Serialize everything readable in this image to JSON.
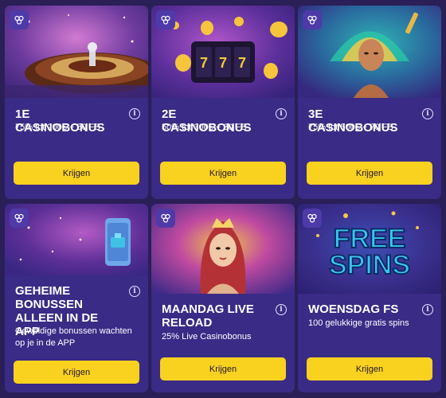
{
  "colors": {
    "page_bg": "#2a1f57",
    "card_bg": "#3a2b86",
    "button_bg": "#f9d11f",
    "button_text": "#1f1637"
  },
  "cards": [
    {
      "title": "1E CASINOBONUS",
      "desc": "75% tot 200€ + 50 FS",
      "button": "Krijgen",
      "image": "roulette-wheel"
    },
    {
      "title": "2E CASINOBONUS",
      "desc": "50% tot 300€ + 30 FS",
      "button": "Krijgen",
      "image": "slot-machine-777"
    },
    {
      "title": "3E CASINOBONUS",
      "desc": "75% tot 500€ + 70 FS",
      "button": "Krijgen",
      "image": "carnival-dancer"
    },
    {
      "title": "GEHEIME BONUSSEN ALLEEN IN DE APP",
      "desc": "Geweldige bonussen wachten op je in de APP",
      "button": "Krijgen",
      "image": "phone-app"
    },
    {
      "title": "MAANDAG LIVE RELOAD",
      "desc": "25% Live Casinobonus",
      "button": "Krijgen",
      "image": "queen-portrait"
    },
    {
      "title": "WOENSDAG FS",
      "desc": "100 gelukkige gratis spins",
      "button": "Krijgen",
      "image": "free-spins-logo",
      "image_text_1": "FREE",
      "image_text_2": "SPINS"
    }
  ],
  "icons": {
    "badge": "gift-icon",
    "info": "info-icon"
  }
}
